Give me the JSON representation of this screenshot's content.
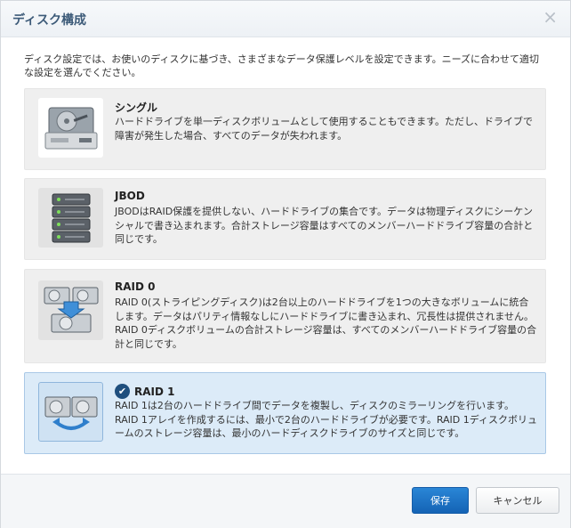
{
  "dialog": {
    "title": "ディスク構成",
    "close_glyph": "×",
    "intro": "ディスク設定では、お使いのディスクに基づき、さまざまなデータ保護レベルを設定できます。ニーズに合わせて適切な設定を選んでください。"
  },
  "options": [
    {
      "title": "シングル",
      "description": "ハードドライブを単一ディスクボリュームとして使用することもできます。ただし、ドライブで障害が発生した場合、すべてのデータが失われます。",
      "icon": "hard-drive-icon",
      "selected": false
    },
    {
      "title": "JBOD",
      "description": "JBODはRAID保護を提供しない、ハードドライブの集合です。データは物理ディスクにシーケンシャルで書き込まれます。合計ストレージ容量はすべてのメンバーハードドライブ容量の合計と同じです。",
      "icon": "server-stack-icon",
      "selected": false
    },
    {
      "title": "RAID 0",
      "description": "RAID 0(ストライピングディスク)は2台以上のハードドライブを1つの大きなボリュームに統合します。データはパリティ情報なしにハードドライブに書き込まれ、冗長性は提供されません。RAID 0ディスクボリュームの合計ストレージ容量は、すべてのメンバーハードドライブ容量の合計と同じです。",
      "icon": "raid0-drives-icon",
      "selected": false
    },
    {
      "title": "RAID 1",
      "description": "RAID 1は2台のハードドライブ間でデータを複製し、ディスクのミラーリングを行います。RAID 1アレイを作成するには、最小で2台のハードドライブが必要です。RAID 1ディスクボリュームのストレージ容量は、最小のハードディスクドライブのサイズと同じです。",
      "icon": "raid1-mirror-icon",
      "selected": true,
      "check_glyph": "✔"
    }
  ],
  "footer": {
    "save_label": "保存",
    "cancel_label": "キャンセル"
  },
  "colors": {
    "accent": "#1a6fc4",
    "selected_bg": "#dcebf8",
    "title_text": "#3c5a78"
  }
}
